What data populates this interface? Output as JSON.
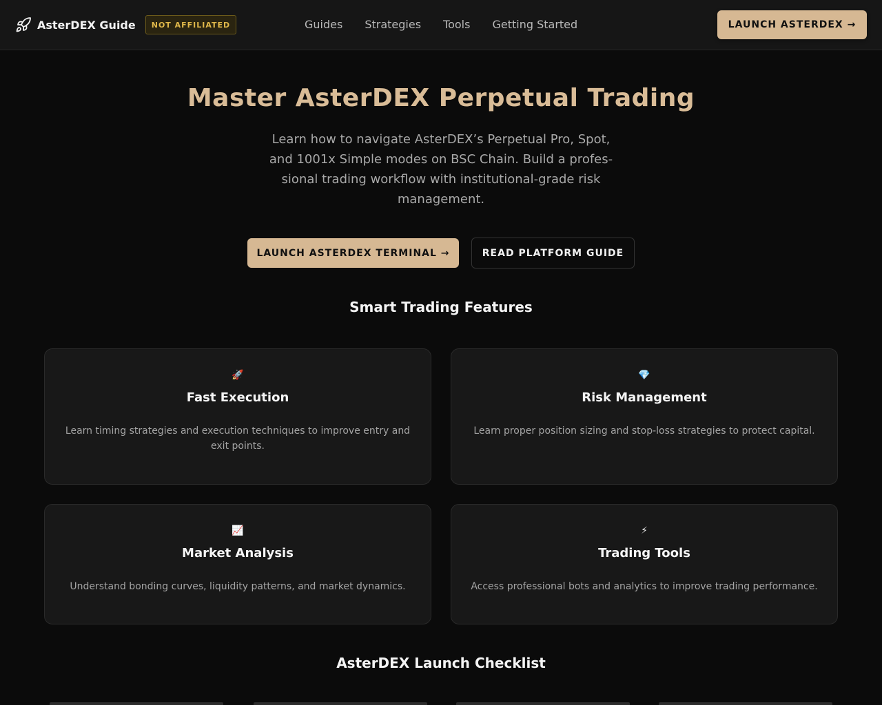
{
  "header": {
    "brand_name": "AsterDEX Guide",
    "brand_icon": "rocket-icon",
    "badge": "NOT AFFILIATED",
    "nav": [
      "Guides",
      "Strategies",
      "Tools",
      "Getting Started"
    ],
    "launch_button": "LAUNCH ASTERDEX →"
  },
  "hero": {
    "title": "Master AsterDEX Perpetual Trading",
    "subtitle": "Learn how to navigate AsterDEX’s Perpetual Pro, Spot, and 1001x Simple modes on BSC Chain. Build a profes­sional trading workflow with institutional-grade risk management.",
    "primary_cta": "LAUNCH ASTERDEX TERMINAL →",
    "secondary_cta": "READ PLATFORM GUIDE"
  },
  "features": {
    "title": "Smart Trading Features",
    "cards": [
      {
        "icon": "🚀",
        "icon_name": "rocket-icon",
        "title": "Fast Execution",
        "desc": "Learn timing strategies and execution techniques to improve entry and exit points."
      },
      {
        "icon": "💎",
        "icon_name": "gem-icon",
        "title": "Risk Management",
        "desc": "Learn proper position sizing and stop-loss strategies to protect capital."
      },
      {
        "icon": "📈",
        "icon_name": "chart-up-icon",
        "title": "Market Analysis",
        "desc": "Understand bonding curves, liquidity patterns, and market dynamics."
      },
      {
        "icon": "⚡",
        "icon_name": "lightning-icon",
        "title": "Trading Tools",
        "desc": "Access professional bots and analytics to improve trading performance."
      }
    ]
  },
  "checklist": {
    "title": "AsterDEX Launch Checklist"
  },
  "colors": {
    "accent": "#d6b893",
    "title_accent": "#d9bc97",
    "badge_text": "#e0b84a",
    "background": "#0b0b0b"
  }
}
